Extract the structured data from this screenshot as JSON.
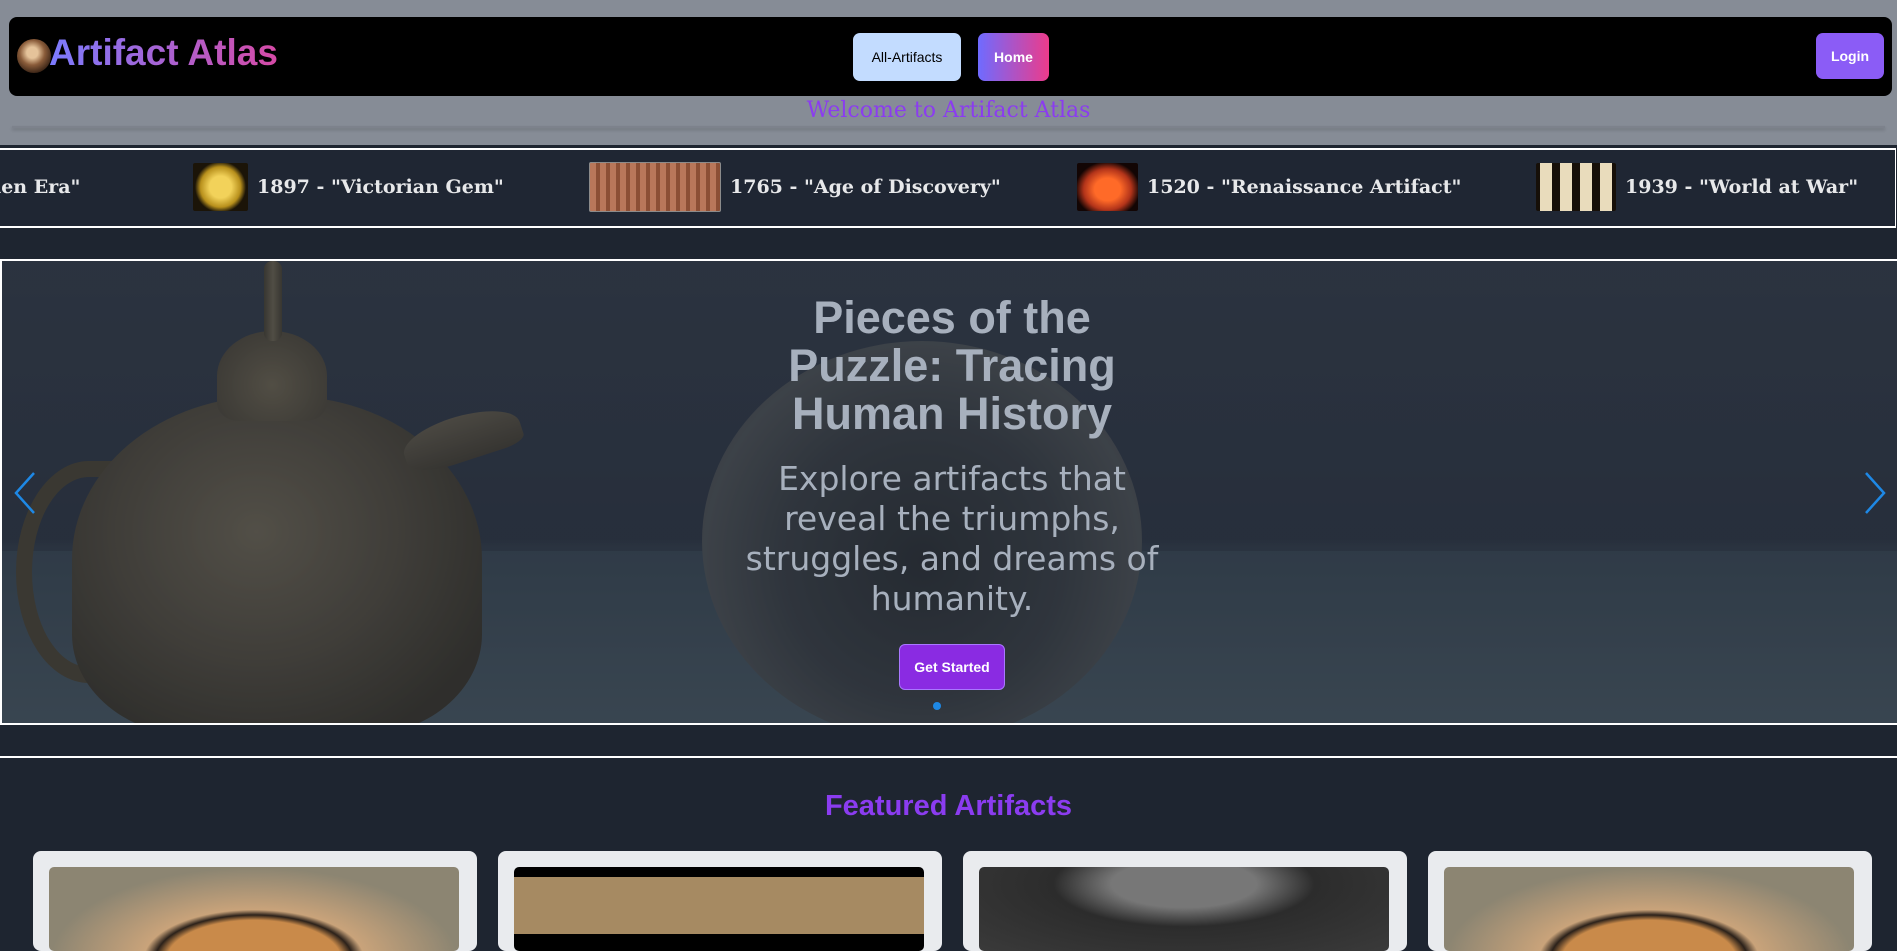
{
  "header": {
    "logo_text": "Artifact Atlas",
    "nav": {
      "all_artifacts": "All-Artifacts",
      "home": "Home"
    },
    "login": "Login",
    "welcome": "Welcome to Artifact Atlas"
  },
  "marquee": {
    "items": [
      {
        "label": "len Era\""
      },
      {
        "label": "1897 - \"Victorian Gem\""
      },
      {
        "label": "1765 - \"Age of Discovery\""
      },
      {
        "label": "1520 - \"Renaissance Artifact\""
      },
      {
        "label": "1939 - \"World at War\""
      }
    ]
  },
  "hero": {
    "title": "Pieces of the Puzzle: Tracing Human History",
    "subtitle": "Explore artifacts that reveal the triumphs, struggles, and dreams of humanity.",
    "cta": "Get Started",
    "prev_icon": "chevron-left-icon",
    "next_icon": "chevron-right-icon"
  },
  "featured": {
    "title": "Featured Artifacts"
  },
  "colors": {
    "accent": "#8b3cf0",
    "navbar_bg": "#000000",
    "carousel_arrow": "#1e88e5"
  }
}
